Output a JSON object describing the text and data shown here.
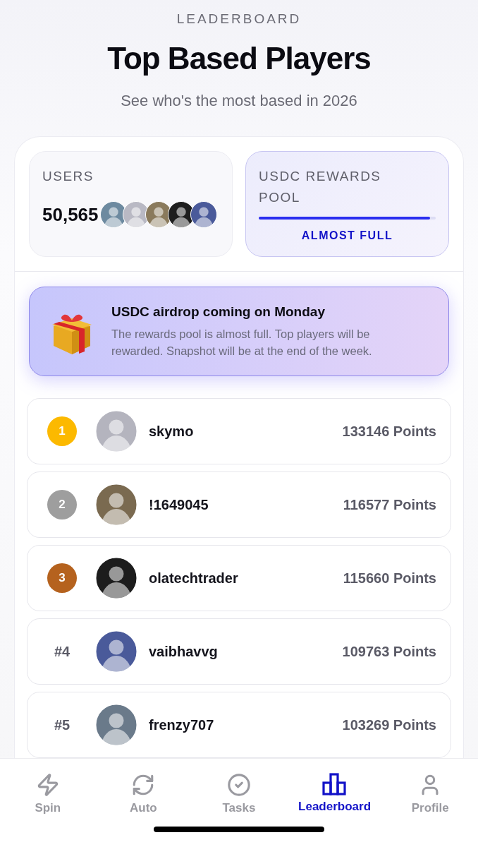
{
  "header": {
    "eyebrow": "LEADERBOARD",
    "title": "Top Based Players",
    "subtitle": "See who's the most based in 2026"
  },
  "stats": {
    "users": {
      "label": "USERS",
      "value": "50,565"
    },
    "pool": {
      "label": "USDC REWARDS POOL",
      "level": 0.97,
      "status": "ALMOST FULL"
    }
  },
  "banner": {
    "title": "USDC airdrop coming on Monday",
    "text": "The rewards pool is almost full. Top players will be rewarded. Snapshot will be at the end of the week."
  },
  "players": [
    {
      "rank": "1",
      "kind": "medal",
      "color": "#fcb900",
      "name": "skymo",
      "points": "133146 Points"
    },
    {
      "rank": "2",
      "kind": "medal",
      "color": "#9e9e9e",
      "name": "!1649045",
      "points": "116577 Points"
    },
    {
      "rank": "3",
      "kind": "medal",
      "color": "#b5621e",
      "name": "olatechtrader",
      "points": "115660 Points"
    },
    {
      "rank": "#4",
      "kind": "plain",
      "name": "vaibhavvg",
      "points": "109763 Points"
    },
    {
      "rank": "#5",
      "kind": "plain",
      "name": "frenzy707",
      "points": "103269 Points"
    }
  ],
  "nav": [
    {
      "label": "Spin",
      "selected": false
    },
    {
      "label": "Auto",
      "selected": false
    },
    {
      "label": "Tasks",
      "selected": false
    },
    {
      "label": "Leaderboard",
      "selected": true
    },
    {
      "label": "Profile",
      "selected": false
    }
  ]
}
